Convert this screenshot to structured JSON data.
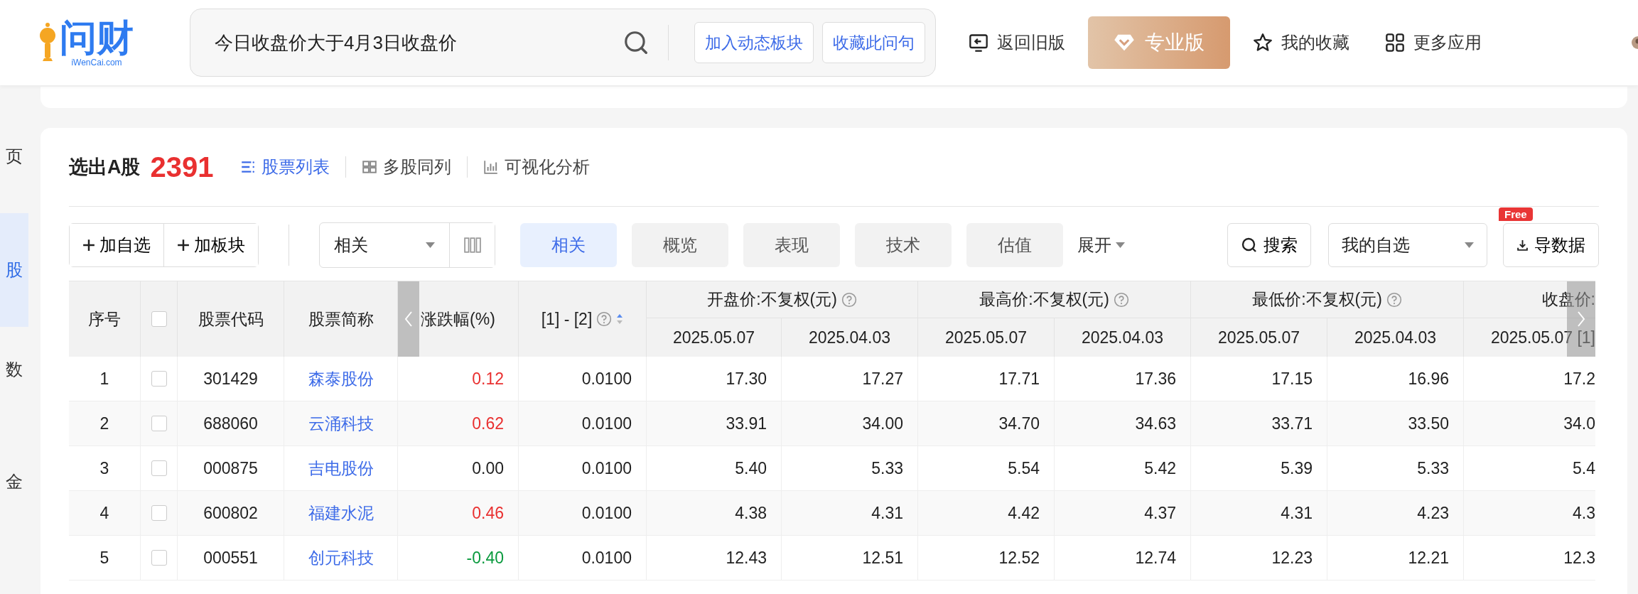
{
  "header": {
    "logo": {
      "name": "问财",
      "domain": "iWenCai.com"
    },
    "search": {
      "value": "今日收盘价大于4月3日收盘价"
    },
    "search_actions": [
      "加入动态板块",
      "收藏此问句"
    ],
    "nav": [
      {
        "kind": "back",
        "label": "返回旧版"
      },
      {
        "kind": "pro",
        "label": "专业版"
      },
      {
        "kind": "star",
        "label": "我的收藏"
      },
      {
        "kind": "apps",
        "label": "更多应用"
      }
    ]
  },
  "sidebar": {
    "items": [
      {
        "label": "页",
        "selected": false
      },
      {
        "label": "股",
        "selected": true
      },
      {
        "label": "数",
        "selected": false
      },
      {
        "label": "金",
        "selected": false
      }
    ]
  },
  "result": {
    "title": "选出A股",
    "count": "2391",
    "views": [
      {
        "kind": "list",
        "label": "股票列表",
        "selected": true
      },
      {
        "kind": "grid",
        "label": "多股同列",
        "selected": false
      },
      {
        "kind": "chart",
        "label": "可视化分析",
        "selected": false
      }
    ]
  },
  "toolbar": {
    "add_buttons": [
      "加自选",
      "加板块"
    ],
    "sort_select": {
      "value": "相关"
    },
    "filters": [
      {
        "label": "相关",
        "selected": true
      },
      {
        "label": "概览",
        "selected": false
      },
      {
        "label": "表现",
        "selected": false
      },
      {
        "label": "技术",
        "selected": false
      },
      {
        "label": "估值",
        "selected": false
      }
    ],
    "expand": "展开",
    "search_button": "搜索",
    "watchlist_select": {
      "value": "我的自选"
    },
    "export": {
      "label": "导数据",
      "badge": "Free"
    }
  },
  "table": {
    "columns": [
      {
        "kind": "text",
        "label": "序号"
      },
      {
        "kind": "checkbox",
        "checked": false
      },
      {
        "kind": "text",
        "label": "股票代码"
      },
      {
        "kind": "text",
        "label": "股票简称"
      },
      {
        "kind": "text",
        "label": "涨跌幅(%)"
      },
      {
        "kind": "sortable",
        "label": "[1] - [2]"
      }
    ],
    "groups": [
      {
        "label": "开盘价:不复权(元)",
        "dates": [
          "2025.05.07",
          "2025.04.03"
        ]
      },
      {
        "label": "最高价:不复权(元)",
        "dates": [
          "2025.05.07",
          "2025.04.03"
        ]
      },
      {
        "label": "最低价:不复权(元)",
        "dates": [
          "2025.05.07",
          "2025.04.03"
        ]
      },
      {
        "label": "收盘价:",
        "dates": [
          "2025.05.07 [1]"
        ]
      }
    ],
    "rows": [
      {
        "no": "1",
        "checked": false,
        "code": "301429",
        "name": "森泰股份",
        "change": "0.12",
        "color": "#e93030",
        "diff": "0.0100",
        "values": [
          "17.30",
          "17.27",
          "17.71",
          "17.36",
          "17.15",
          "16.96",
          "17.2"
        ]
      },
      {
        "no": "2",
        "checked": false,
        "code": "688060",
        "name": "云涌科技",
        "change": "0.62",
        "color": "#e93030",
        "diff": "0.0100",
        "values": [
          "33.91",
          "34.00",
          "34.70",
          "34.63",
          "33.71",
          "33.50",
          "34.0"
        ]
      },
      {
        "no": "3",
        "checked": false,
        "code": "000875",
        "name": "吉电股份",
        "change": "0.00",
        "color": "#222222",
        "diff": "0.0100",
        "values": [
          "5.40",
          "5.33",
          "5.54",
          "5.42",
          "5.39",
          "5.33",
          "5.4"
        ]
      },
      {
        "no": "4",
        "checked": false,
        "code": "600802",
        "name": "福建水泥",
        "change": "0.46",
        "color": "#e93030",
        "diff": "0.0100",
        "values": [
          "4.38",
          "4.31",
          "4.42",
          "4.37",
          "4.31",
          "4.23",
          "4.3"
        ]
      },
      {
        "no": "5",
        "checked": false,
        "code": "000551",
        "name": "创元科技",
        "change": "-0.40",
        "color": "#0a9a3e",
        "diff": "0.0100",
        "values": [
          "12.43",
          "12.51",
          "12.52",
          "12.74",
          "12.23",
          "12.21",
          "12.3"
        ]
      }
    ]
  }
}
